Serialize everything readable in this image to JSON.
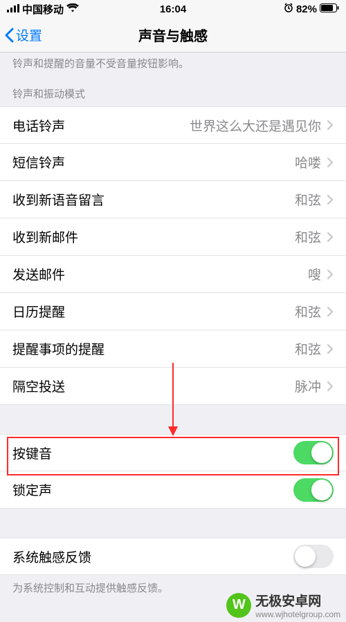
{
  "status": {
    "signal_carrier": "中国移动",
    "time": "16:04",
    "battery_pct": "82%"
  },
  "nav": {
    "back_label": "设置",
    "title": "声音与触感"
  },
  "notes": {
    "top_truncated": "铃声和提醒的音量不受音量按钮影响。",
    "section_sounds": "铃声和振动模式",
    "footer_haptic": "为系统控制和互动提供触感反馈。"
  },
  "rows_sounds": [
    {
      "label": "电话铃声",
      "value": "世界这么大还是遇见你"
    },
    {
      "label": "短信铃声",
      "value": "哈喽"
    },
    {
      "label": "收到新语音留言",
      "value": "和弦"
    },
    {
      "label": "收到新邮件",
      "value": "和弦"
    },
    {
      "label": "发送邮件",
      "value": "嗖"
    },
    {
      "label": "日历提醒",
      "value": "和弦"
    },
    {
      "label": "提醒事项的提醒",
      "value": "和弦"
    },
    {
      "label": "隔空投送",
      "value": "脉冲"
    }
  ],
  "rows_switches": [
    {
      "label": "按键音",
      "on": true
    },
    {
      "label": "锁定声",
      "on": true
    }
  ],
  "rows_haptic": [
    {
      "label": "系统触感反馈",
      "on": false
    }
  ],
  "watermark": {
    "brand": "无极安卓网",
    "url": "www.wjhotelgroup.com"
  }
}
